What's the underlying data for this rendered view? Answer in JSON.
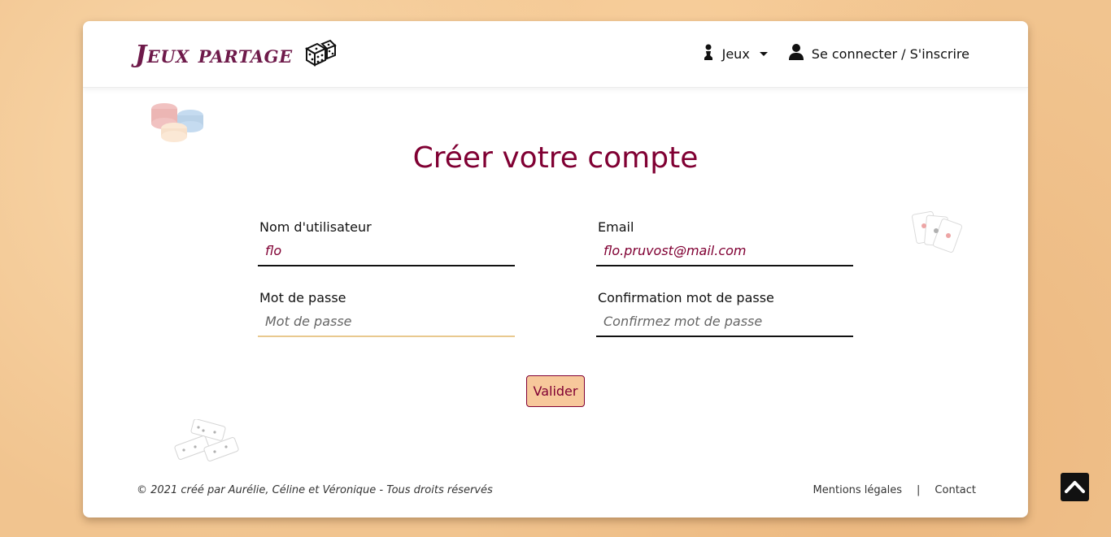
{
  "brand": {
    "name": "Jeux partage",
    "icon": "dice-icon"
  },
  "nav": {
    "games_label": "Jeux",
    "games_icon": "pawn-icon",
    "login_label": "Se connecter / S'inscrire",
    "login_icon": "user-icon"
  },
  "page": {
    "title": "Créer votre compte"
  },
  "form": {
    "username": {
      "label": "Nom d'utilisateur",
      "value": "flo",
      "placeholder": ""
    },
    "email": {
      "label": "Email",
      "value": "flo.pruvost@mail.com",
      "placeholder": ""
    },
    "password": {
      "label": "Mot de passe",
      "value": "",
      "placeholder": "Mot de passe"
    },
    "confirm": {
      "label": "Confirmation mot de passe",
      "value": "",
      "placeholder": "Confirmez mot de passe"
    },
    "submit_label": "Valider"
  },
  "footer": {
    "copyright": "© 2021 créé par Aurélie, Céline et Véronique - Tous droits réservés",
    "links": [
      "Mentions légales",
      "Contact"
    ],
    "separator": "|"
  },
  "colors": {
    "accent": "#800033",
    "brand": "#6e1a4a",
    "button_bg": "#f7c89b"
  },
  "decorations": [
    "poker-chips-icon",
    "playing-cards-icon",
    "dominoes-icon"
  ],
  "back_to_top_icon": "chevron-up-icon"
}
